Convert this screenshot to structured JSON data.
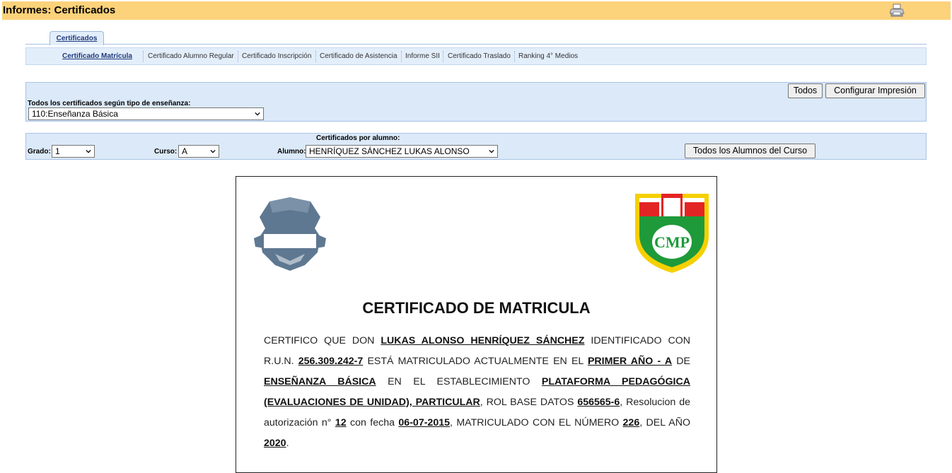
{
  "header": {
    "title": "Informes: Certificados",
    "print_icon": "printer-icon"
  },
  "tabs": {
    "main": "Certificados"
  },
  "subtabs": [
    "Certificado Matrícula",
    "Certificado Alumno Regular",
    "Certificado Inscripción",
    "Certificado de Asistencia",
    "Informe SII",
    "Certificado Traslado",
    "Ranking 4° Medios"
  ],
  "filters": {
    "tipo_label": "Todos los certificados según tipo de enseñanza:",
    "tipo_value": "110:Enseñanza Básica",
    "todos_button": "Todos",
    "config_button": "Configurar Impresión",
    "por_alumno_label": "Certificados por alumno:",
    "grado_label": "Grado:",
    "grado_value": "1",
    "curso_label": "Curso:",
    "curso_value": "A",
    "alumno_label": "Alumno:",
    "alumno_value": "HENRÍQUEZ SÁNCHEZ LUKAS ALONSO",
    "todos_alumnos_button": "Todos los Alumnos del Curso"
  },
  "certificate": {
    "title": "CERTIFICADO DE MATRICULA",
    "t1": "CERTIFICO QUE DON ",
    "student": "LUKAS ALONSO HENRÍQUEZ SÁNCHEZ",
    "t2": " IDENTIFICADO CON R.U.N. ",
    "run": "256.309.242-7",
    "t3": " ESTÁ MATRICULADO ACTUALMENTE EN EL ",
    "course": "PRIMER AÑO - A",
    "t4": " DE ",
    "level": "ENSEÑANZA BÁSICA",
    "t5": " EN EL ESTABLECIMIENTO ",
    "school": "PLATAFORMA PEDAGÓGICA (EVALUACIONES DE UNIDAD), PARTICULAR",
    "t6": ", ROL BASE DATOS ",
    "rbd": "656565-6",
    "t7": ", Resolucion de autorización n° ",
    "resolution": "12",
    "t8": " con fecha ",
    "date": "06-07-2015",
    "t9": ", MATRICULADO CON EL NÚMERO ",
    "number": "226",
    "t10": ", DEL AÑO ",
    "year": "2020",
    "t11": ".",
    "logo_right_text": "CMP"
  },
  "colors": {
    "title_bar": "#fcd27a",
    "panel": "#dbe9f8",
    "crest_gray": "#5f7891",
    "crest_green": "#1e9a3a",
    "crest_red": "#e32424",
    "crest_yellow": "#f5d000"
  }
}
